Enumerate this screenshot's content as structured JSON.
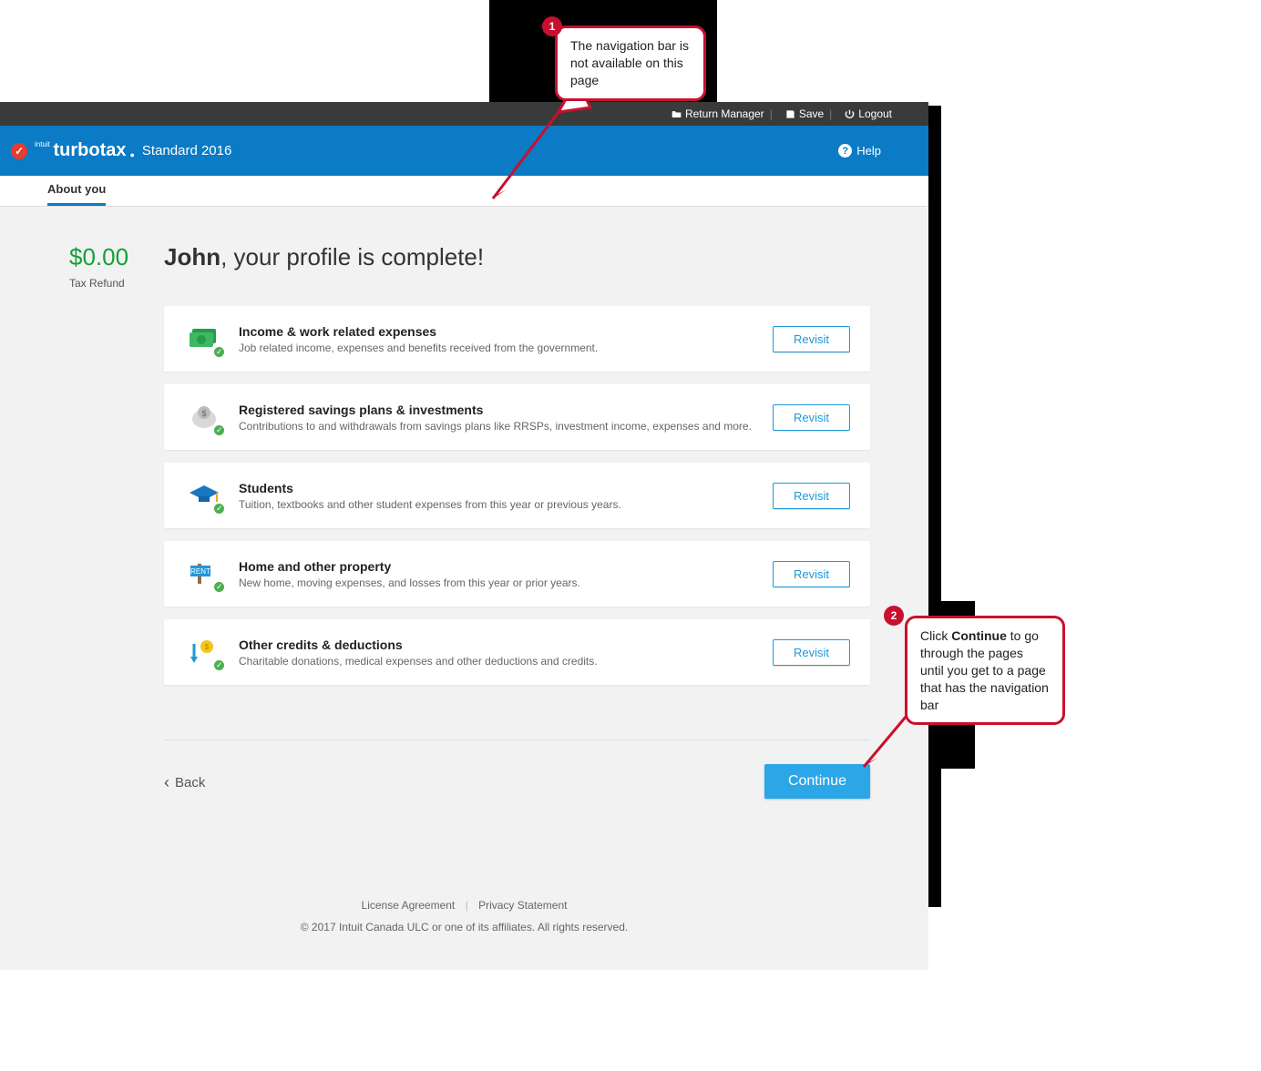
{
  "topbar": {
    "return_manager": "Return Manager",
    "save": "Save",
    "logout": "Logout"
  },
  "brand": {
    "intuit": "intuit",
    "name": "turbotax",
    "product": "Standard 2016"
  },
  "help_label": "Help",
  "tab_about": "About you",
  "refund": {
    "amount": "$0.00",
    "label": "Tax Refund"
  },
  "headline": {
    "name": "John",
    "rest": ", your profile is complete!"
  },
  "revisit_label": "Revisit",
  "cards": [
    {
      "title": "Income & work related expenses",
      "desc": "Job related income, expenses and benefits received from the government.",
      "icon": "money"
    },
    {
      "title": "Registered savings plans & investments",
      "desc": "Contributions to and withdrawals from savings plans like RRSPs, investment income, expenses and more.",
      "icon": "piggy"
    },
    {
      "title": "Students",
      "desc": "Tuition, textbooks and other student expenses from this year or previous years.",
      "icon": "cap"
    },
    {
      "title": "Home and other property",
      "desc": "New home, moving expenses, and losses from this year or prior years.",
      "icon": "rent"
    },
    {
      "title": "Other credits & deductions",
      "desc": "Charitable donations, medical expenses and other deductions and credits.",
      "icon": "coins"
    }
  ],
  "back_label": "Back",
  "continue_label": "Continue",
  "footer": {
    "license": "License Agreement",
    "privacy": "Privacy Statement",
    "copyright": "© 2017 Intuit Canada ULC or one of its affiliates. All rights reserved."
  },
  "callouts": {
    "c1": {
      "num": "1",
      "text": "The navigation bar is not available on this page"
    },
    "c2": {
      "num": "2",
      "pre": "Click ",
      "bold": "Continue",
      "post": " to go through the pages until you get to a page that has the navigation bar"
    }
  }
}
